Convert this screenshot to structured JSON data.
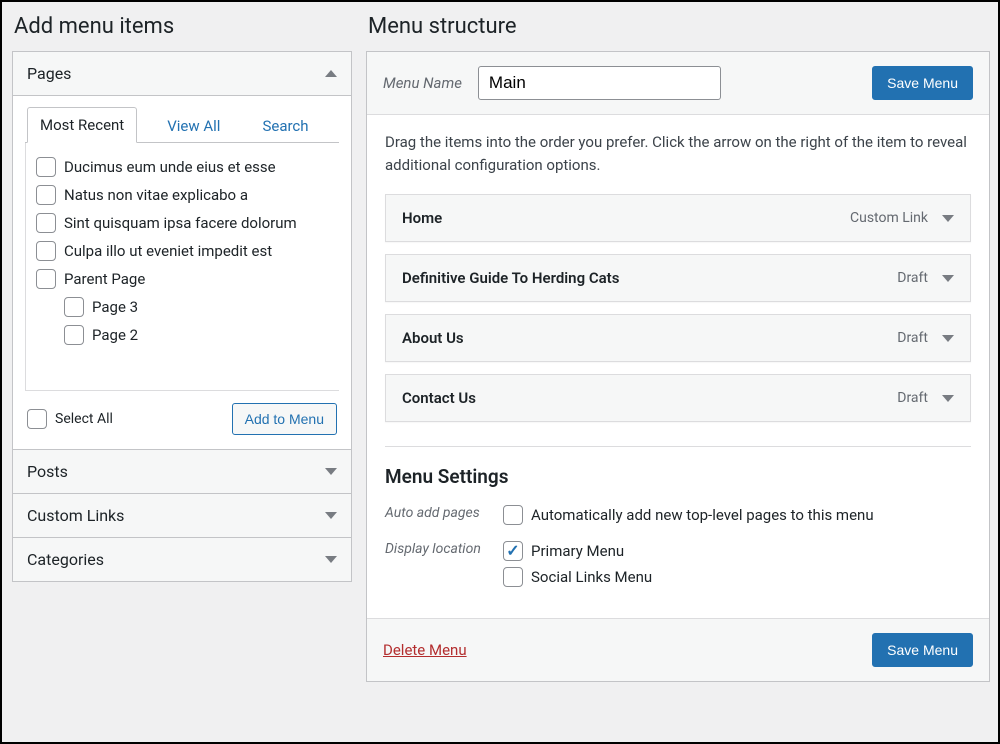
{
  "left": {
    "title": "Add menu items",
    "sections": {
      "pages": "Pages",
      "posts": "Posts",
      "custom_links": "Custom Links",
      "categories": "Categories"
    },
    "tabs": {
      "most_recent": "Most Recent",
      "view_all": "View All",
      "search": "Search"
    },
    "pages_list": [
      {
        "label": "Ducimus eum unde eius et esse",
        "indent": false
      },
      {
        "label": "Natus non vitae explicabo a",
        "indent": false
      },
      {
        "label": "Sint quisquam ipsa facere dolorum",
        "indent": false
      },
      {
        "label": "Culpa illo ut eveniet impedit est",
        "indent": false
      },
      {
        "label": "Parent Page",
        "indent": false
      },
      {
        "label": "Page 3",
        "indent": true
      },
      {
        "label": "Page 2",
        "indent": true
      }
    ],
    "select_all": "Select All",
    "add_to_menu": "Add to Menu"
  },
  "right": {
    "title": "Menu structure",
    "menu_name_label": "Menu Name",
    "menu_name_value": "Main",
    "save_menu": "Save Menu",
    "instructions": "Drag the items into the order you prefer. Click the arrow on the right of the item to reveal additional configuration options.",
    "items": [
      {
        "title": "Home",
        "type": "Custom Link"
      },
      {
        "title": "Definitive Guide To Herding Cats",
        "type": "Draft"
      },
      {
        "title": "About Us",
        "type": "Draft"
      },
      {
        "title": "Contact Us",
        "type": "Draft"
      }
    ],
    "settings": {
      "heading": "Menu Settings",
      "auto_add_label": "Auto add pages",
      "auto_add_option": "Automatically add new top-level pages to this menu",
      "display_location_label": "Display location",
      "loc_primary": "Primary Menu",
      "loc_social": "Social Links Menu"
    },
    "delete_menu": "Delete Menu"
  }
}
